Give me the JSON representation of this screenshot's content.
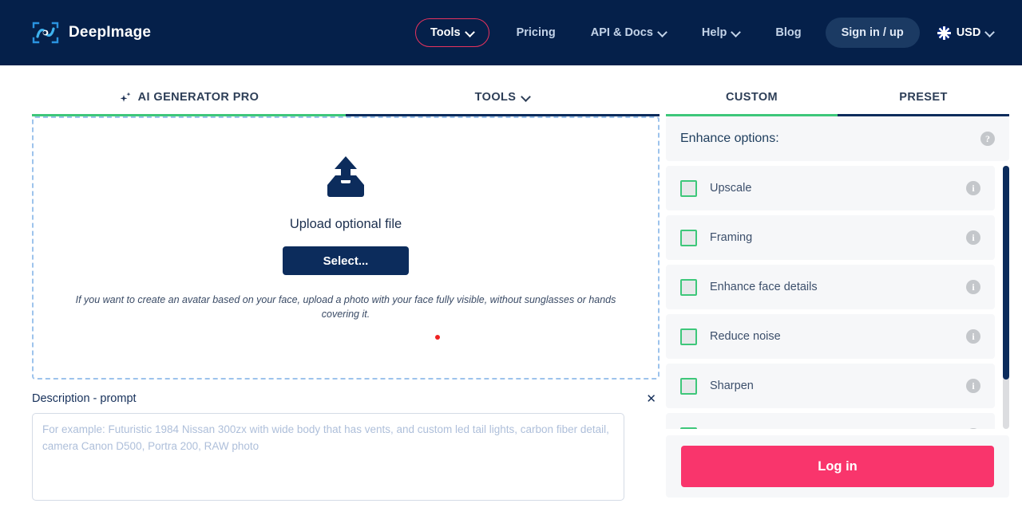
{
  "header": {
    "brand": "DeepImage",
    "logo_icon": "deepimage-eye-logo",
    "nav": [
      {
        "label": "Tools",
        "icon": "chevron-down-icon",
        "has_caret": true,
        "style": "pill"
      },
      {
        "label": "Pricing",
        "has_caret": false,
        "style": "plain"
      },
      {
        "label": "API & Docs",
        "icon": "chevron-down-icon",
        "has_caret": true,
        "style": "plain"
      },
      {
        "label": "Help",
        "icon": "chevron-down-icon",
        "has_caret": true,
        "style": "plain"
      },
      {
        "label": "Blog",
        "has_caret": false,
        "style": "plain"
      }
    ],
    "signin_label": "Sign in / up",
    "currency": {
      "label": "USD",
      "flag_icon": "uk-flag-icon",
      "caret_icon": "chevron-down-icon"
    }
  },
  "left_tabs": [
    {
      "label": "AI GENERATOR PRO",
      "icon": "sparkles-icon",
      "active": true
    },
    {
      "label": "TOOLS",
      "icon": "chevron-down-icon",
      "active": false
    }
  ],
  "right_tabs": [
    {
      "label": "CUSTOM",
      "active": true
    },
    {
      "label": "PRESET",
      "active": false
    }
  ],
  "dropzone": {
    "icon": "upload-tray-icon",
    "title": "Upload optional file",
    "button_label": "Select...",
    "hint": "If you want to create an avatar based on your face, upload a photo with your face fully visible, without sunglasses or hands covering it."
  },
  "description": {
    "label": "Description - prompt",
    "close_icon": "close-icon",
    "placeholder": "For example: Futuristic 1984 Nissan 300zx with wide body that has vents, and custom led tail lights, carbon fiber detail, camera Canon D500, Portra 200, RAW photo",
    "value": ""
  },
  "enhance_panel": {
    "title": "Enhance options:",
    "help_icon": "question-mark-icon",
    "help_glyph": "?",
    "options": [
      {
        "label": "Upscale",
        "checked": false,
        "info_icon": "info-icon",
        "info_glyph": "i"
      },
      {
        "label": "Framing",
        "checked": false,
        "info_icon": "info-icon",
        "info_glyph": "i"
      },
      {
        "label": "Enhance face details",
        "checked": false,
        "info_icon": "info-icon",
        "info_glyph": "i"
      },
      {
        "label": "Reduce noise",
        "checked": false,
        "info_icon": "info-icon",
        "info_glyph": "i"
      },
      {
        "label": "Sharpen",
        "checked": false,
        "info_icon": "info-icon",
        "info_glyph": "i"
      },
      {
        "label": "",
        "checked": false,
        "info_icon": "info-icon",
        "info_glyph": "i"
      }
    ]
  },
  "login": {
    "label": "Log in"
  },
  "colors": {
    "navy": "#05204a",
    "dark_navy": "#0c2c5c",
    "accent_pink": "#f9356c",
    "pill_border": "#e8325e",
    "green": "#3ec77a",
    "panel_bg": "#f6f7f9",
    "red_dot": "#ef2222"
  }
}
